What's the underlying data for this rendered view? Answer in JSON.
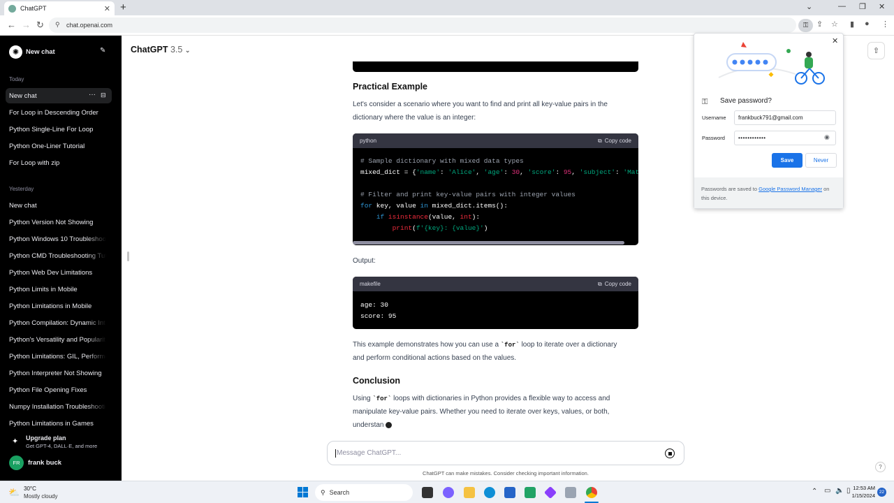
{
  "browser": {
    "tab_title": "ChatGPT",
    "url": "chat.openai.com"
  },
  "sidebar": {
    "new_chat": "New chat",
    "sections": [
      {
        "label": "Today",
        "items": [
          "New chat",
          "For Loop in Descending Order",
          "Python Single-Line For Loop",
          "Python One-Liner Tutorial",
          "For Loop with zip"
        ]
      },
      {
        "label": "Yesterday",
        "items": [
          "New chat",
          "Python Version Not Showing",
          "Python Windows 10 Troubleshoot",
          "Python CMD Troubleshooting Tut",
          "Python Web Dev Limitations",
          "Python Limits in Mobile",
          "Python Limitations in Mobile",
          "Python Compilation: Dynamic Int",
          "Python's Versatility and Popularit",
          "Python Limitations: GIL, Performa",
          "Python Interpreter Not Showing",
          "Python File Opening Fixes",
          "Numpy Installation Troubleshooti",
          "Python Limitations in Games"
        ]
      }
    ],
    "upgrade_title": "Upgrade plan",
    "upgrade_sub": "Get GPT-4, DALL·E, and more",
    "user_initials": "FR",
    "user_name": "frank buck"
  },
  "header": {
    "model": "ChatGPT",
    "version": "3.5"
  },
  "content": {
    "heading1": "Practical Example",
    "para1_line1": "Let's consider a scenario where you want to find and print all key-value pairs in the",
    "para1_line2": "dictionary where the value is an integer:",
    "code1_lang": "python",
    "copy_label": "Copy code",
    "output_label": "Output:",
    "code2_lang": "makefile",
    "code2_line1": "age: 30",
    "code2_line2": "score: 95",
    "para2_pre": "This example demonstrates how you can use a ",
    "para2_code": "`for`",
    "para2_post": " loop to iterate over a dictionary",
    "para2_line2": "and perform conditional actions based on the values.",
    "heading2": "Conclusion",
    "para3_pre": "Using ",
    "para3_code": "`for`",
    "para3_post": " loops with dictionaries in Python provides a flexible way to access and",
    "para3_line2": "manipulate key-value pairs. Whether you need to iterate over keys, values, or both,",
    "para3_line3": "understan"
  },
  "composer": {
    "placeholder": "Message ChatGPT...",
    "disclaimer": "ChatGPT can make mistakes. Consider checking important information."
  },
  "password_popup": {
    "title": "Save password?",
    "username_label": "Username",
    "username_value": "frankbuck791@gmail.com",
    "password_label": "Password",
    "password_value": "••••••••••••",
    "save": "Save",
    "never": "Never",
    "footer_pre": "Passwords are saved to ",
    "footer_link": "Google Password Manager",
    "footer_post": " on this device."
  },
  "taskbar": {
    "weather_temp": "30°C",
    "weather_desc": "Mostly cloudy",
    "search": "Search",
    "time": "12:53 AM",
    "date": "1/15/2024",
    "notifications": "22"
  }
}
